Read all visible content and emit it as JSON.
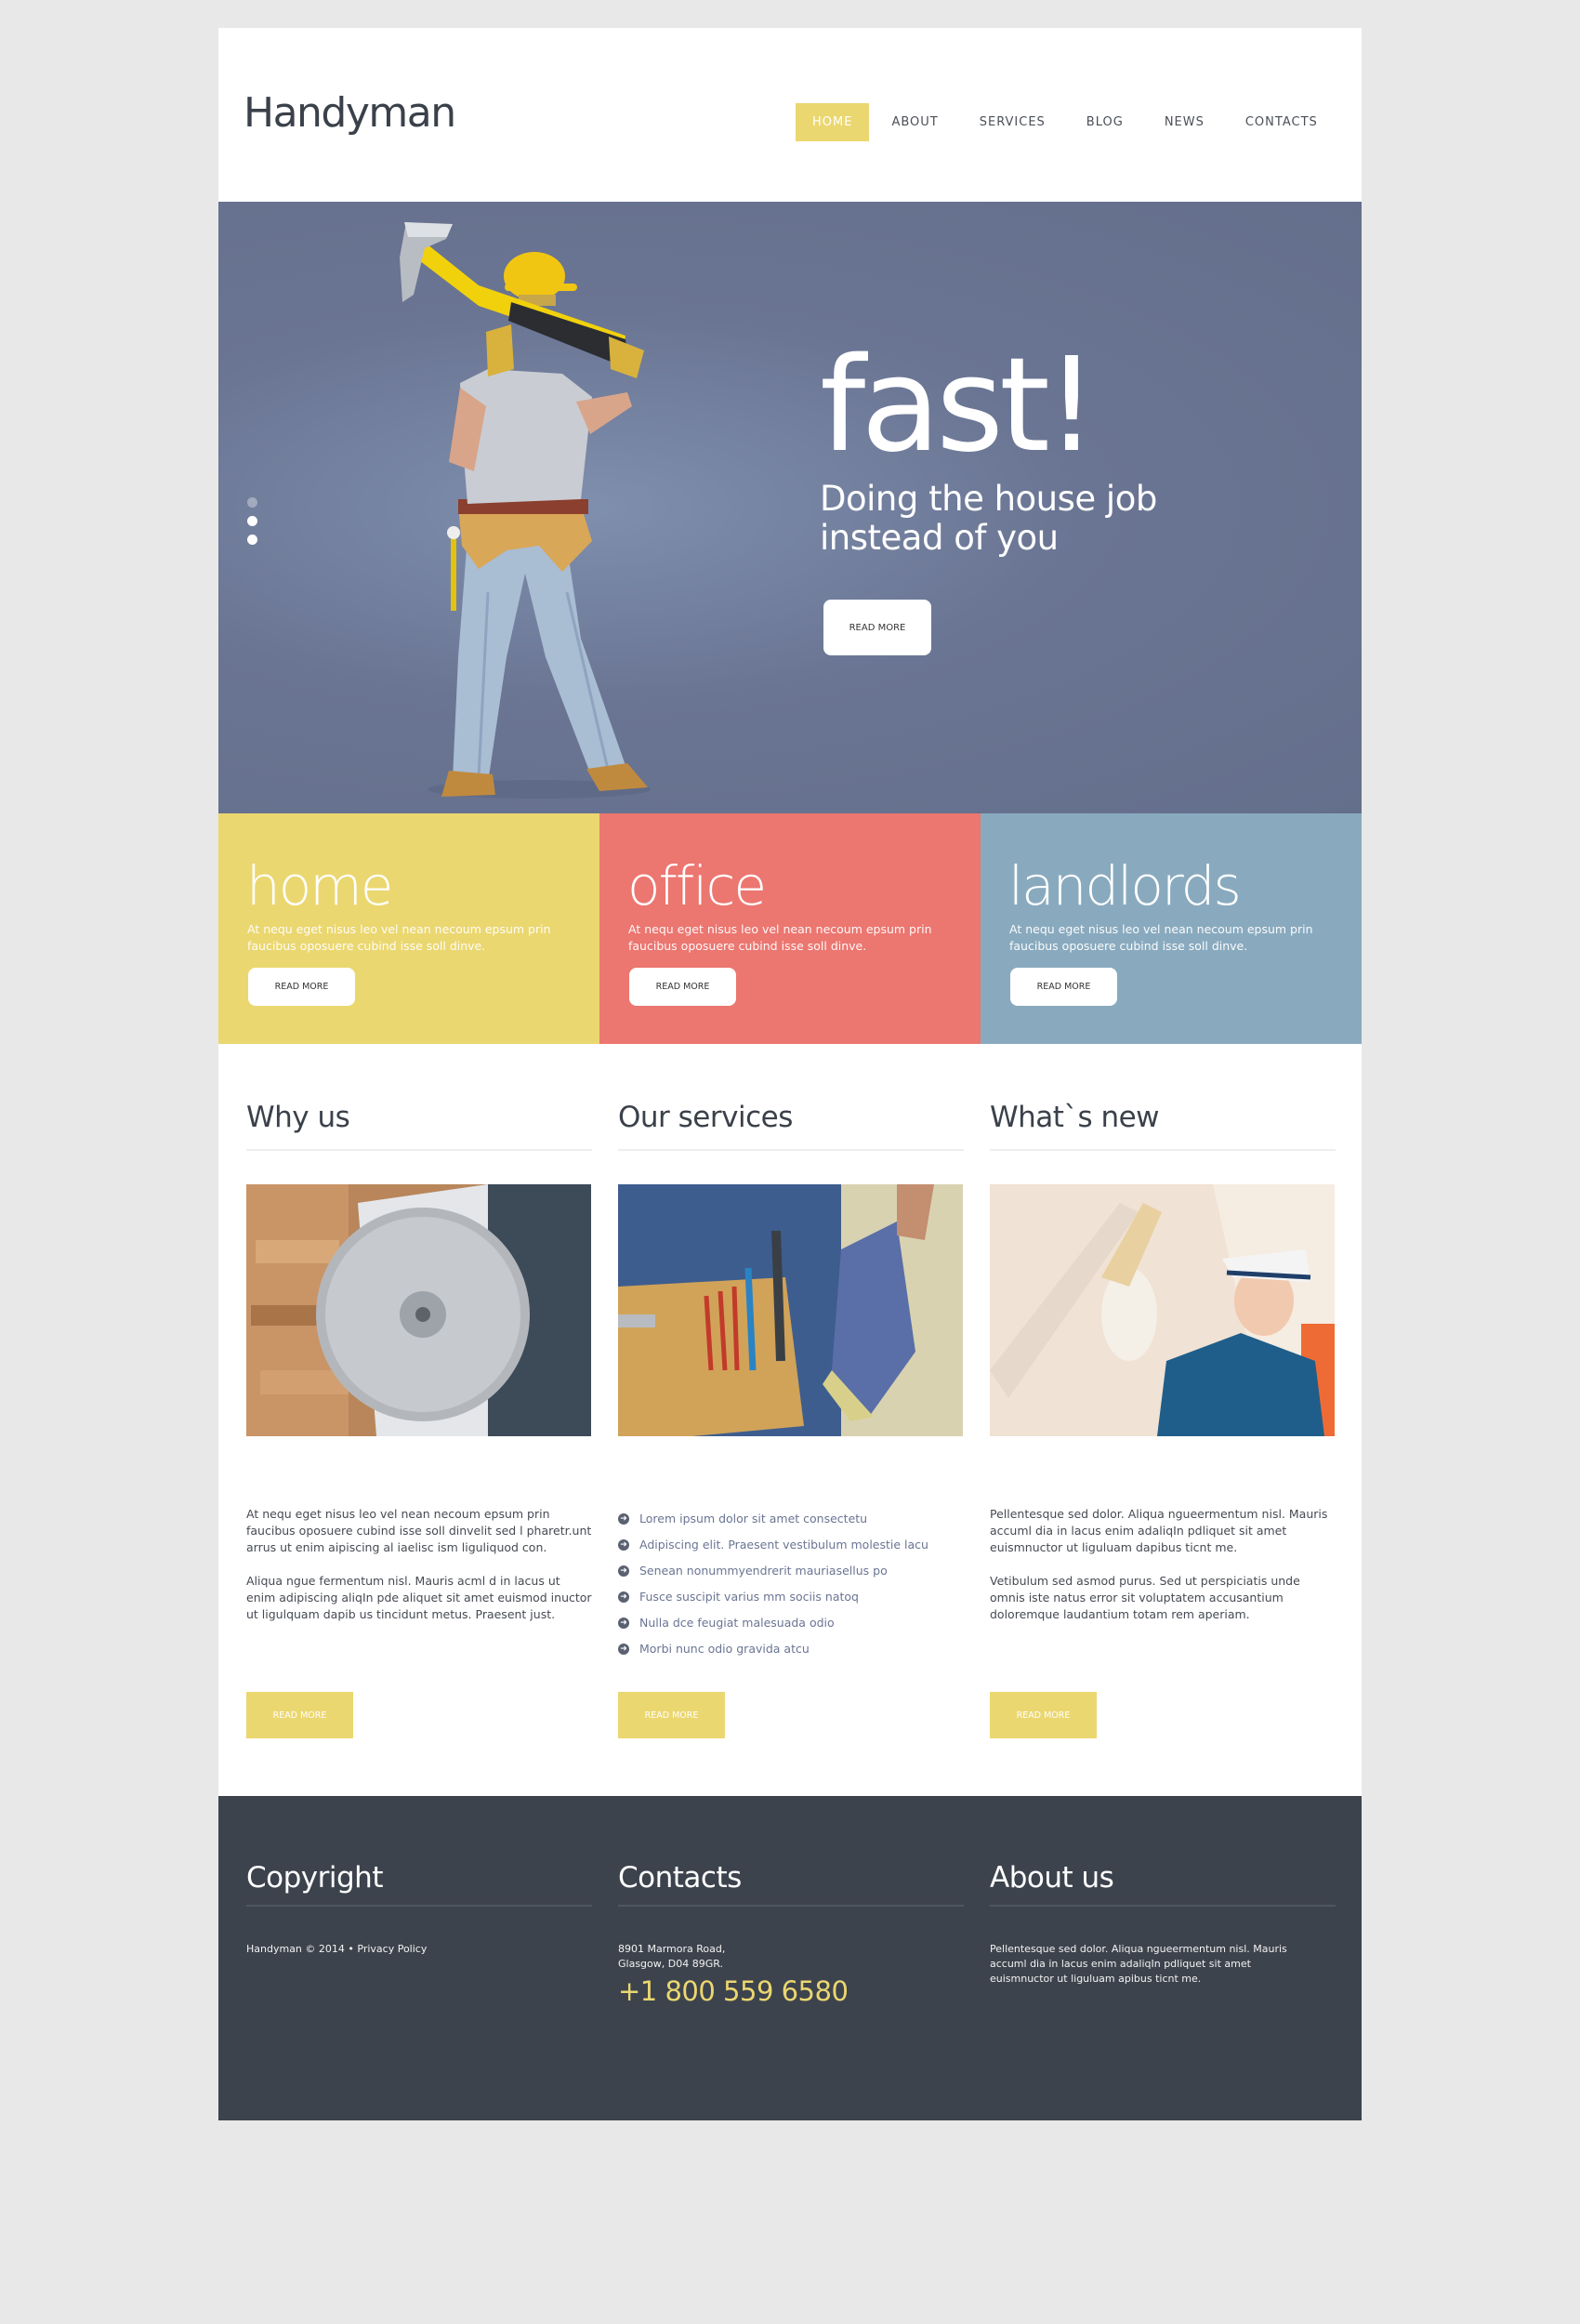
{
  "header": {
    "logo": "Handyman",
    "nav": [
      {
        "label": "HOME",
        "active": true
      },
      {
        "label": "ABOUT",
        "active": false
      },
      {
        "label": "SERVICES",
        "active": false
      },
      {
        "label": "BLOG",
        "active": false
      },
      {
        "label": "NEWS",
        "active": false
      },
      {
        "label": "CONTACTS",
        "active": false
      }
    ]
  },
  "hero": {
    "headline": "fast!",
    "subline_1": "Doing the house job",
    "subline_2": "instead of you",
    "button": "READ MORE",
    "slides_count": 3,
    "active_slide": 1,
    "image": "worker-with-hammer"
  },
  "tiles": [
    {
      "title": "home",
      "text": "At nequ eget nisus leo vel nean necoum epsum prin faucibus oposuere cubind isse soll dinve.",
      "button": "READ MORE",
      "color": "#ebd770"
    },
    {
      "title": "office",
      "text": "At nequ eget nisus leo vel nean necoum epsum prin faucibus oposuere cubind isse soll dinve.",
      "button": "READ MORE",
      "color": "#ec7670"
    },
    {
      "title": "landlords",
      "text": "At nequ eget nisus leo vel nean necoum epsum prin faucibus oposuere cubind isse soll dinve.",
      "button": "READ MORE",
      "color": "#89aabe"
    }
  ],
  "columns": {
    "why_us": {
      "title": "Why us",
      "image": "circular-saw",
      "p1": "At nequ eget nisus leo vel nean necoum epsum prin faucibus oposuere cubind isse soll dinvelit sed l pharetr.unt arrus ut enim aipiscing al iaelisc ism liguliquod con.",
      "p2": "Aliqua ngue fermentum nisl. Mauris acml d in lacus ut enim adipiscing aliqIn pde aliquet sit amet euismod inuctor ut ligulquam dapib us tincidunt metus. Praesent just.",
      "button": "READ MORE"
    },
    "services": {
      "title": "Our services",
      "image": "tool-belt",
      "items": [
        "Lorem ipsum dolor sit amet consectetu",
        "Adipiscing elit. Praesent vestibulum molestie lacu",
        "Senean nonummyendrerit mauriasellus po",
        "Fusce suscipit varius mm sociis natoq",
        "Nulla dce feugiat malesuada odio",
        "Morbi nunc odio gravida atcu"
      ],
      "button": "READ MORE"
    },
    "whats_new": {
      "title": "What`s new",
      "image": "woman-sanding-wall",
      "p1": "Pellentesque sed dolor. Aliqua ngueermentum nisl. Mauris accuml dia in lacus enim adaliqIn pdliquet sit amet euismnuctor ut liguluam dapibus ticnt me.",
      "p2": "Vetibulum sed asmod purus. Sed ut perspiciatis unde omnis iste natus error sit voluptatem accusantium doloremque laudantium totam rem aperiam.",
      "button": "READ MORE"
    }
  },
  "footer": {
    "copyright": {
      "title": "Copyright",
      "text": "Handyman © 2014 • ",
      "link": "Privacy Policy"
    },
    "contacts": {
      "title": "Contacts",
      "address_1": "8901 Marmora Road,",
      "address_2": "Glasgow, D04 89GR.",
      "phone": "+1 800 559 6580"
    },
    "about": {
      "title": "About us",
      "text": "Pellentesque sed dolor. Aliqua ngueermentum nisl. Mauris accuml dia in lacus enim adaliqIn pdliquet sit amet euismnuctor ut liguluam apibus ticnt me."
    }
  },
  "colors": {
    "accent": "#ebd770",
    "hero_bg": "#67728f",
    "tile_red": "#ec7670",
    "tile_blue": "#89aabe",
    "footer_bg": "#3d434d",
    "text_dark": "#3b414a"
  }
}
